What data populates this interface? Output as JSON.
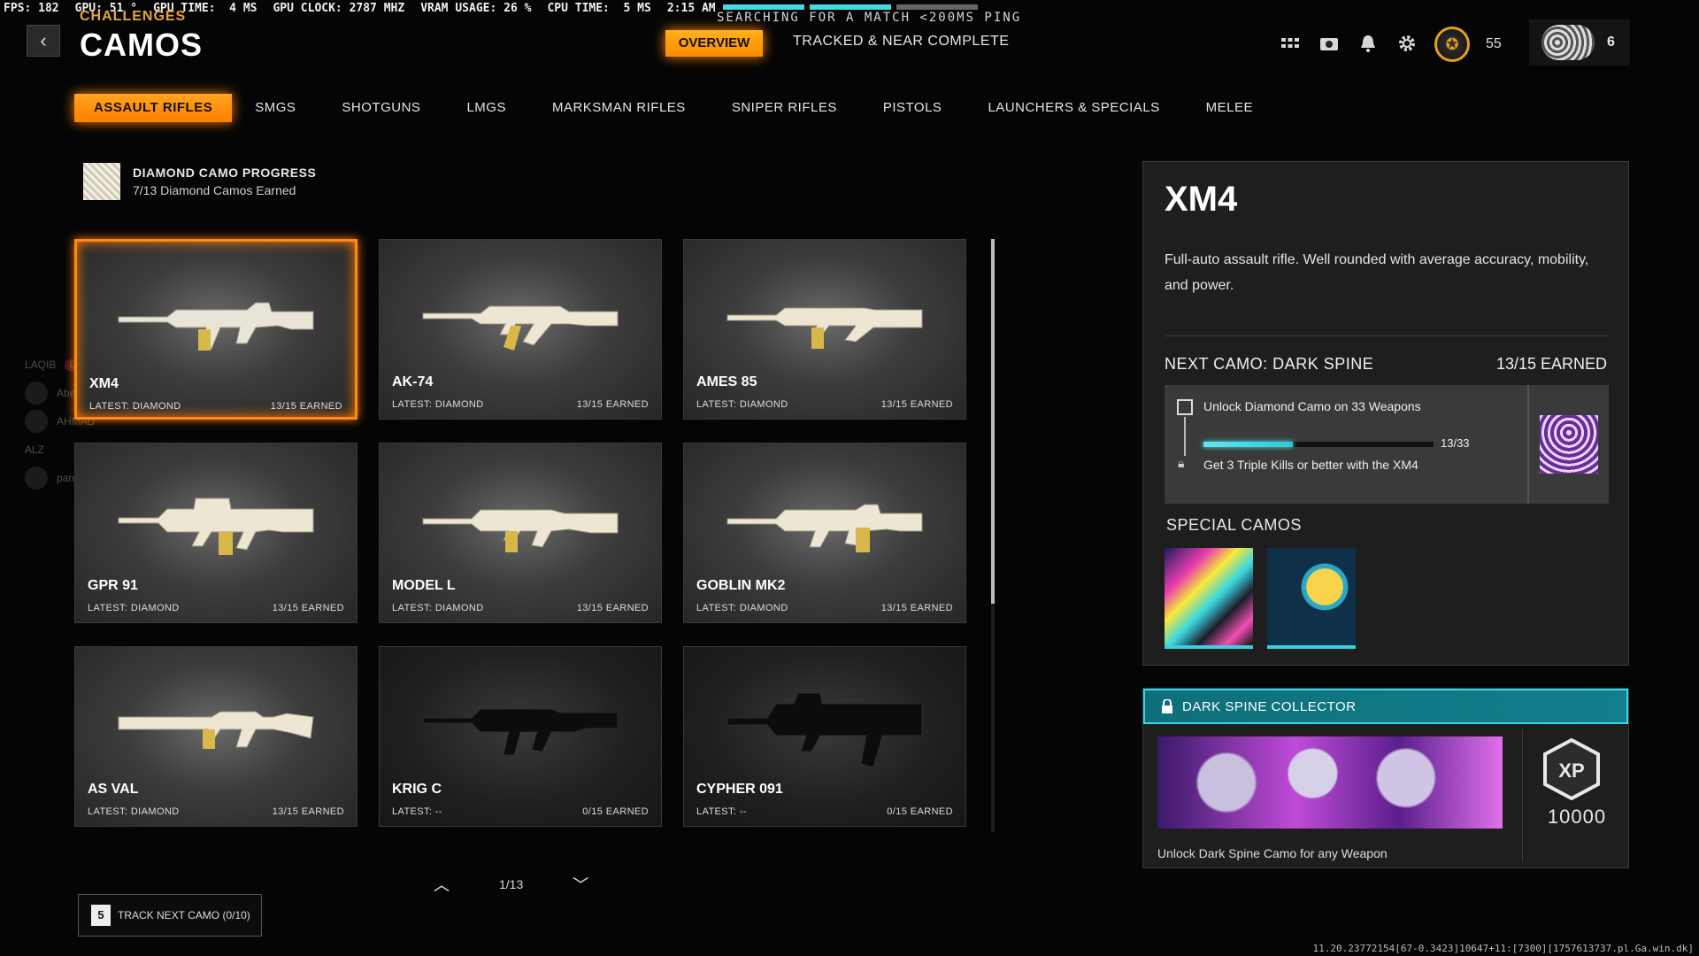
{
  "perf": {
    "fps": "FPS: 182",
    "gpu": "GPU: 51 °",
    "gpu_time": "GPU TIME:  4 MS",
    "gpu_clock": "GPU CLOCK: 2787 MHZ",
    "vram": "VRAM USAGE: 26 %",
    "cpu_time": "CPU TIME:  5 MS",
    "clock": "2:15 AM"
  },
  "matchmaking": {
    "status": "SEARCHING FOR A MATCH <200MS PING"
  },
  "header": {
    "supertitle": "CHALLENGES",
    "title": "CAMOS",
    "tabs": {
      "overview": "OVERVIEW",
      "tracked": "TRACKED & NEAR COMPLETE"
    },
    "level": "55",
    "player_count": "6"
  },
  "icons": {
    "back": "chevron-left-icon",
    "grid": "grid-icon",
    "camera": "camera-icon",
    "bell": "bell-icon",
    "gear": "gear-icon",
    "prestige": "prestige-icon",
    "lock": "lock-icon",
    "xp": "xp-icon"
  },
  "colors": {
    "accent": "#ff8a00",
    "progress": "#4ee0ea",
    "collector": "#127f8b"
  },
  "categories": [
    "ASSAULT RIFLES",
    "SMGS",
    "SHOTGUNS",
    "LMGS",
    "MARKSMAN RIFLES",
    "SNIPER RIFLES",
    "PISTOLS",
    "LAUNCHERS & SPECIALS",
    "MELEE"
  ],
  "diamond_progress": {
    "title": "DIAMOND CAMO PROGRESS",
    "subtitle": "7/13 Diamond Camos Earned"
  },
  "weapons": [
    {
      "name": "XM4",
      "latest": "LATEST: DIAMOND",
      "earned": "13/15 EARNED"
    },
    {
      "name": "AK-74",
      "latest": "LATEST: DIAMOND",
      "earned": "13/15 EARNED"
    },
    {
      "name": "AMES 85",
      "latest": "LATEST: DIAMOND",
      "earned": "13/15 EARNED"
    },
    {
      "name": "GPR 91",
      "latest": "LATEST: DIAMOND",
      "earned": "13/15 EARNED"
    },
    {
      "name": "MODEL L",
      "latest": "LATEST: DIAMOND",
      "earned": "13/15 EARNED"
    },
    {
      "name": "GOBLIN MK2",
      "latest": "LATEST: DIAMOND",
      "earned": "13/15 EARNED"
    },
    {
      "name": "AS VAL",
      "latest": "LATEST: DIAMOND",
      "earned": "13/15 EARNED"
    },
    {
      "name": "KRIG C",
      "latest": "LATEST: --",
      "earned": "0/15 EARNED"
    },
    {
      "name": "CYPHER 091",
      "latest": "LATEST: --",
      "earned": "0/15 EARNED"
    }
  ],
  "pager": {
    "label": "1/13"
  },
  "track_button": {
    "key": "5",
    "label": "TRACK NEXT CAMO (0/10)"
  },
  "friends": [
    "LAQIB",
    "LIVE",
    "Abed",
    "AHMAD",
    "ALZ",
    "panZORD"
  ],
  "detail": {
    "name": "XM4",
    "description": "Full-auto assault rifle.  Well rounded with average accuracy, mobility, and power.",
    "next_camo": "NEXT CAMO: DARK SPINE",
    "next_earned": "13/15 EARNED",
    "challenge": {
      "title": "Unlock Diamond Camo on 33 Weapons",
      "progress": "13/33",
      "fraction": 0.39,
      "subtitle": "Get 3 Triple Kills or better with the XM4"
    },
    "special_title": "SPECIAL CAMOS"
  },
  "collector": {
    "title": "DARK SPINE COLLECTOR",
    "xp": "10000",
    "description": "Unlock Dark Spine Camo for any Weapon"
  },
  "build": "11.20.23772154[67-0.3423]10647+11:[7300][1757613737.pl.Ga.win.dk]"
}
